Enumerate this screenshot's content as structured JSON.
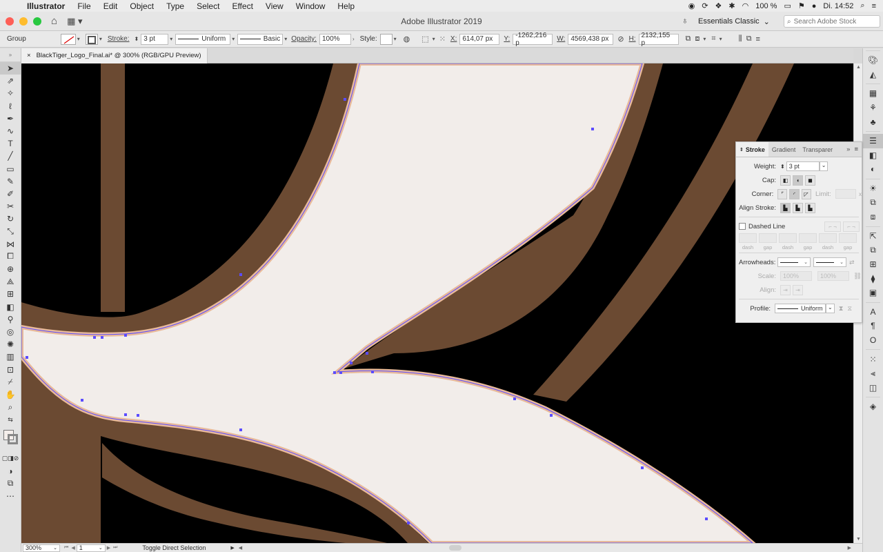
{
  "menubar": {
    "app": "Illustrator",
    "items": [
      "File",
      "Edit",
      "Object",
      "Type",
      "Select",
      "Effect",
      "View",
      "Window",
      "Help"
    ],
    "battery": "100 %",
    "clock": "Di. 14:52"
  },
  "titlebar": {
    "title": "Adobe Illustrator 2019",
    "workspace": "Essentials Classic",
    "search_placeholder": "Search Adobe Stock"
  },
  "controlbar": {
    "selection": "Group",
    "stroke_label": "Stroke:",
    "stroke_weight": "3 pt",
    "profile": "Uniform",
    "brush": "Basic",
    "opacity_label": "Opacity:",
    "opacity": "100%",
    "style_label": "Style:",
    "x_label": "X:",
    "x": "614,07 px",
    "y_label": "Y:",
    "y": "-1262,216 p",
    "w_label": "W:",
    "w": "4569,438 px",
    "h_label": "H:",
    "h": "2132,155 p"
  },
  "document": {
    "tab_title": "BlackTiger_Logo_Final.ai* @ 300% (RGB/GPU Preview)",
    "close": "×"
  },
  "statusbar": {
    "zoom": "300%",
    "artboard": "1",
    "status": "Toggle Direct Selection"
  },
  "stroke_panel": {
    "tabs": [
      "Stroke",
      "Gradient",
      "Transparer"
    ],
    "weight_label": "Weight:",
    "weight": "3 pt",
    "cap_label": "Cap:",
    "corner_label": "Corner:",
    "limit_label": "Limit:",
    "limit_x": "x",
    "align_label": "Align Stroke:",
    "dashed_label": "Dashed Line",
    "dash_caps": [
      "dash",
      "gap",
      "dash",
      "gap",
      "dash",
      "gap"
    ],
    "arrowheads_label": "Arrowheads:",
    "scale_label": "Scale:",
    "scale_1": "100%",
    "scale_2": "100%",
    "align_arrow_label": "Align:",
    "profile_label": "Profile:",
    "profile": "Uniform"
  },
  "colors": {
    "canvas": "#000000",
    "brown": "#6b4a32",
    "peach": "#e8b99a",
    "cream": "#f2edea",
    "path": "#5b4cff"
  }
}
